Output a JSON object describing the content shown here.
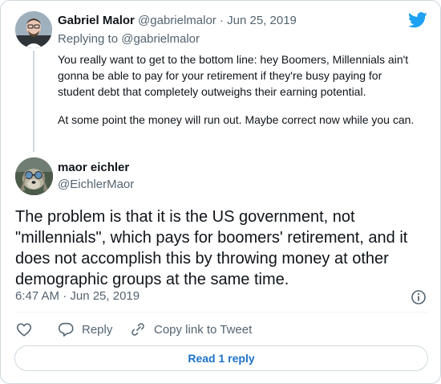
{
  "parent_tweet": {
    "display_name": "Gabriel Malor",
    "handle": "@gabrielmalor",
    "separator": "·",
    "date": "Jun 25, 2019",
    "replying_label": "Replying to",
    "replying_to": "@gabrielmalor",
    "paragraphs": [
      "You really want to get to the bottom line: hey Boomers, Millennials ain't gonna be able to pay for your retirement if they're busy paying for student debt that completely outweighs their earning potential.",
      "At some point the money will run out. Maybe correct now while you can."
    ],
    "avatar_icon": "avatar-gabriel-malor"
  },
  "main_tweet": {
    "display_name": "maor eichler",
    "handle": "@EichlerMaor",
    "text": "The problem is that it is the US government, not \"millennials\", which pays for boomers' retirement, and it does not accomplish this by throwing money at other demographic groups at the same time.",
    "timestamp": "6:47 AM · Jun 25, 2019",
    "avatar_icon": "avatar-maor-eichler"
  },
  "actions": {
    "like_icon": "heart-icon",
    "reply_icon": "reply-icon",
    "reply_label": "Reply",
    "copy_icon": "link-icon",
    "copy_label": "Copy link to Tweet"
  },
  "footer": {
    "read_replies_label": "Read 1 reply"
  },
  "brand": {
    "logo_icon": "twitter-bird-icon",
    "color": "#1da1f2"
  },
  "info_icon": "info-icon"
}
